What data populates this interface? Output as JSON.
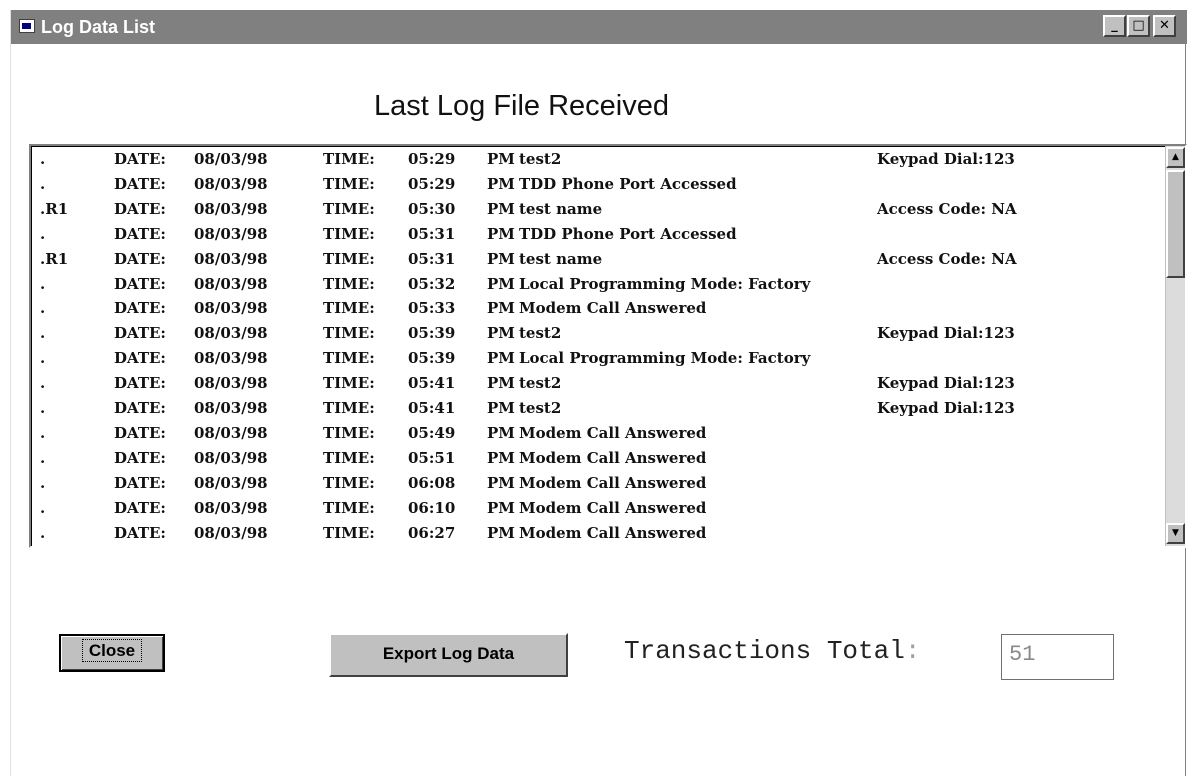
{
  "window": {
    "title": "Log Data List",
    "controls": {
      "minimize": "_",
      "maximize": "□",
      "close": "✕"
    }
  },
  "heading": "Last Log File Received",
  "log": {
    "rows": [
      {
        "prefix": ".",
        "date_label": "DATE:",
        "date": "08/03/98",
        "time_label": "TIME:",
        "time": "05:29",
        "ampm": "PM",
        "desc": "test2",
        "extra": "Keypad Dial:123"
      },
      {
        "prefix": ".",
        "date_label": "DATE:",
        "date": "08/03/98",
        "time_label": "TIME:",
        "time": "05:29",
        "ampm": "PM",
        "desc": "TDD Phone Port Accessed",
        "extra": ""
      },
      {
        "prefix": ".R1",
        "date_label": "DATE:",
        "date": "08/03/98",
        "time_label": "TIME:",
        "time": "05:30",
        "ampm": "PM",
        "desc": "test name",
        "extra": "Access Code: NA"
      },
      {
        "prefix": ".",
        "date_label": "DATE:",
        "date": "08/03/98",
        "time_label": "TIME:",
        "time": "05:31",
        "ampm": "PM",
        "desc": "TDD Phone Port Accessed",
        "extra": ""
      },
      {
        "prefix": ".R1",
        "date_label": "DATE:",
        "date": "08/03/98",
        "time_label": "TIME:",
        "time": "05:31",
        "ampm": "PM",
        "desc": "test name",
        "extra": "Access Code: NA"
      },
      {
        "prefix": ".",
        "date_label": "DATE:",
        "date": "08/03/98",
        "time_label": "TIME:",
        "time": "05:32",
        "ampm": "PM",
        "desc": "Local Programming Mode: Factory",
        "extra": ""
      },
      {
        "prefix": ".",
        "date_label": "DATE:",
        "date": "08/03/98",
        "time_label": "TIME:",
        "time": "05:33",
        "ampm": "PM",
        "desc": "Modem Call Answered",
        "extra": ""
      },
      {
        "prefix": ".",
        "date_label": "DATE:",
        "date": "08/03/98",
        "time_label": "TIME:",
        "time": "05:39",
        "ampm": "PM",
        "desc": "test2",
        "extra": "Keypad Dial:123"
      },
      {
        "prefix": ".",
        "date_label": "DATE:",
        "date": "08/03/98",
        "time_label": "TIME:",
        "time": "05:39",
        "ampm": "PM",
        "desc": "Local Programming Mode: Factory",
        "extra": ""
      },
      {
        "prefix": ".",
        "date_label": "DATE:",
        "date": "08/03/98",
        "time_label": "TIME:",
        "time": "05:41",
        "ampm": "PM",
        "desc": "test2",
        "extra": "Keypad Dial:123"
      },
      {
        "prefix": ".",
        "date_label": "DATE:",
        "date": "08/03/98",
        "time_label": "TIME:",
        "time": "05:41",
        "ampm": "PM",
        "desc": "test2",
        "extra": "Keypad Dial:123"
      },
      {
        "prefix": ".",
        "date_label": "DATE:",
        "date": "08/03/98",
        "time_label": "TIME:",
        "time": "05:49",
        "ampm": "PM",
        "desc": "Modem Call Answered",
        "extra": ""
      },
      {
        "prefix": ".",
        "date_label": "DATE:",
        "date": "08/03/98",
        "time_label": "TIME:",
        "time": "05:51",
        "ampm": "PM",
        "desc": "Modem Call Answered",
        "extra": ""
      },
      {
        "prefix": ".",
        "date_label": "DATE:",
        "date": "08/03/98",
        "time_label": "TIME:",
        "time": "06:08",
        "ampm": "PM",
        "desc": "Modem Call Answered",
        "extra": ""
      },
      {
        "prefix": ".",
        "date_label": "DATE:",
        "date": "08/03/98",
        "time_label": "TIME:",
        "time": "06:10",
        "ampm": "PM",
        "desc": "Modem Call Answered",
        "extra": ""
      },
      {
        "prefix": ".",
        "date_label": "DATE:",
        "date": "08/03/98",
        "time_label": "TIME:",
        "time": "06:27",
        "ampm": "PM",
        "desc": "Modem Call Answered",
        "extra": ""
      }
    ],
    "scroll": {
      "up_glyph": "▲",
      "down_glyph": "▼"
    }
  },
  "buttons": {
    "close_label": "Close",
    "export_label": "Export Log Data"
  },
  "transactions": {
    "label": "Transactions Total",
    "colon": ":",
    "value": "51"
  }
}
